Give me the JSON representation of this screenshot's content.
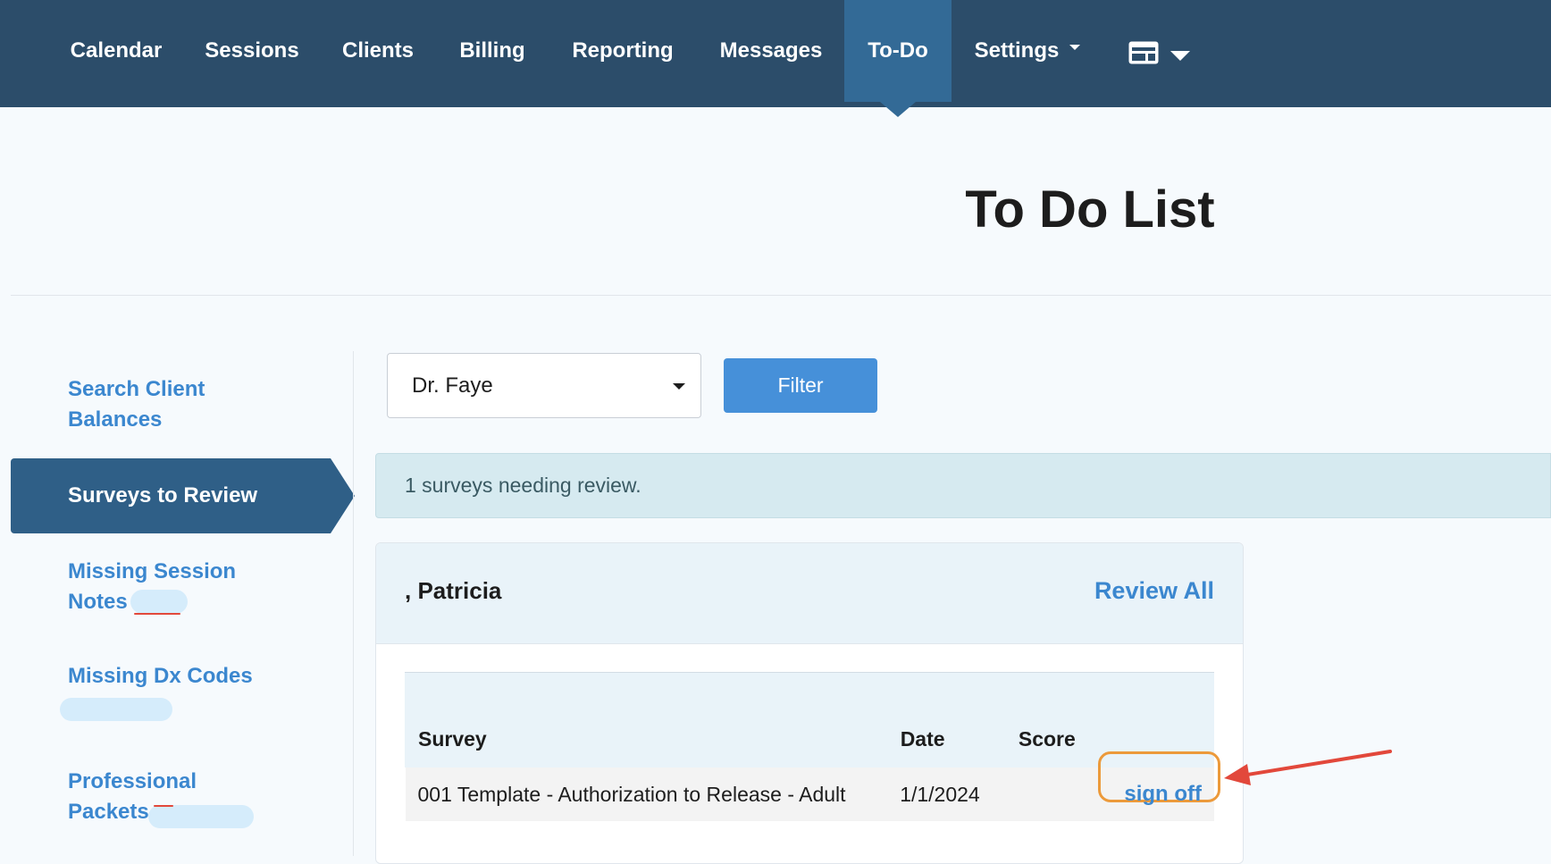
{
  "nav": {
    "items": [
      {
        "label": "Calendar"
      },
      {
        "label": "Sessions"
      },
      {
        "label": "Clients"
      },
      {
        "label": "Billing"
      },
      {
        "label": "Reporting"
      },
      {
        "label": "Messages"
      },
      {
        "label": "To-Do",
        "active": true
      },
      {
        "label": "Settings",
        "dropdown": true
      }
    ],
    "layout_menu_icon": "layout-icon"
  },
  "page": {
    "title": "To Do List"
  },
  "sidebar": {
    "items": [
      {
        "label_line1": "Search Client",
        "label_line2": "Balances"
      },
      {
        "label": "Surveys to Review",
        "active": true
      },
      {
        "label_line1": "Missing Session",
        "label_line2": "Notes"
      },
      {
        "label": "Missing Dx Codes"
      },
      {
        "label_line1": "Professional",
        "label_line2": "Packets"
      }
    ]
  },
  "filter": {
    "provider_selected": "Dr. Faye",
    "button_label": "Filter"
  },
  "alert": {
    "text": "1 surveys needing review."
  },
  "client_card": {
    "client_name": ", Patricia",
    "review_all_label": "Review All",
    "columns": [
      "Survey",
      "Date",
      "Score",
      ""
    ],
    "rows": [
      {
        "survey": "001 Template - Authorization to Release - Adult",
        "date": "1/1/2024",
        "score": "",
        "action": "sign off"
      }
    ]
  },
  "colors": {
    "nav_bg": "#2c4d6a",
    "nav_active": "#336a96",
    "link_blue": "#3b87cf",
    "highlight_orange": "#ec9a3b",
    "annotation_red": "#e2483b"
  }
}
